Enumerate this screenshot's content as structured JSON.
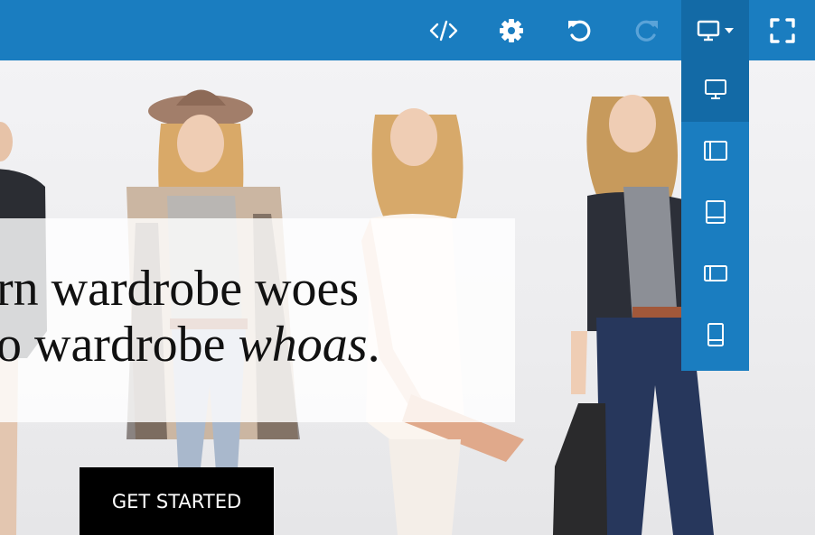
{
  "toolbar": {
    "buttons": [
      {
        "icon": "code-icon",
        "name": "code-view"
      },
      {
        "icon": "gear-icon",
        "name": "settings"
      },
      {
        "icon": "undo-icon",
        "name": "undo"
      },
      {
        "icon": "redo-icon",
        "name": "redo",
        "disabled": true
      },
      {
        "icon": "desktop-icon",
        "name": "device-selector",
        "active": true
      },
      {
        "icon": "fullscreen-icon",
        "name": "fullscreen"
      }
    ]
  },
  "device_menu": {
    "items": [
      {
        "icon": "desktop-icon",
        "device": "desktop",
        "selected": true
      },
      {
        "icon": "tablet-landscape-icon",
        "device": "tablet-landscape"
      },
      {
        "icon": "tablet-portrait-icon",
        "device": "tablet-portrait"
      },
      {
        "icon": "mobile-landscape-icon",
        "device": "mobile-landscape"
      },
      {
        "icon": "mobile-portrait-icon",
        "device": "mobile-portrait"
      }
    ]
  },
  "hero": {
    "headline_line1": "rn wardrobe woes",
    "headline_line2_prefix": "o wardrobe ",
    "headline_line2_emphasis": "whoas",
    "headline_line2_suffix": ".",
    "cta_label": "GET STARTED"
  },
  "colors": {
    "toolbar": "#1a7dc0",
    "toolbar_active": "#136aa6",
    "cta_background": "#000000"
  }
}
